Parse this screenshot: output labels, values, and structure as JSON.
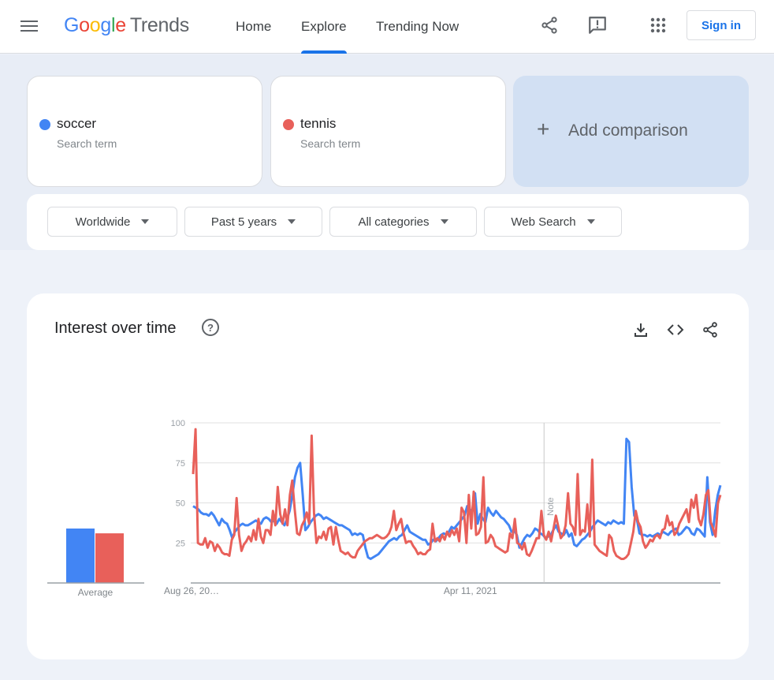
{
  "header": {
    "logo": {
      "google": "Google",
      "product": "Trends"
    },
    "nav": [
      {
        "label": "Home",
        "active": false
      },
      {
        "label": "Explore",
        "active": true
      },
      {
        "label": "Trending Now",
        "active": false
      }
    ],
    "icons": [
      "share-icon",
      "feedback-icon",
      "apps-icon"
    ],
    "sign_in_label": "Sign in",
    "accent_color": "#1a73e8"
  },
  "terms": [
    {
      "term": "soccer",
      "subtitle": "Search term",
      "color": "#4285f4"
    },
    {
      "term": "tennis",
      "subtitle": "Search term",
      "color": "#e8605a"
    }
  ],
  "add_comparison": {
    "icon": "+",
    "label": "Add comparison"
  },
  "filters": [
    {
      "label": "Worldwide"
    },
    {
      "label": "Past 5 years"
    },
    {
      "label": "All categories"
    },
    {
      "label": "Web Search"
    }
  ],
  "card": {
    "title": "Interest over time",
    "help_icon": "?",
    "actions": [
      "download-icon",
      "embed-icon",
      "share-icon"
    ]
  },
  "chart_data": [
    {
      "type": "bar",
      "title": "Average",
      "categories": [
        "Average"
      ],
      "series": [
        {
          "name": "soccer",
          "color": "#4285f4",
          "values": [
            34
          ]
        },
        {
          "name": "tennis",
          "color": "#e8605a",
          "values": [
            31
          ]
        }
      ],
      "xlabel": "Average",
      "ylim": [
        0,
        100
      ]
    },
    {
      "type": "line",
      "title": "Interest over time",
      "xlabel": "",
      "ylabel": "",
      "ylim": [
        0,
        100
      ],
      "yticks": [
        25,
        50,
        75,
        100
      ],
      "xtick_labels": [
        {
          "label": "Aug 26, 20…",
          "position": 0.0
        },
        {
          "label": "Apr 11, 2021",
          "position": 0.528
        }
      ],
      "note_marker": {
        "label": "Note",
        "position": 0.667
      },
      "grid": true,
      "legend": "none",
      "series": [
        {
          "name": "soccer",
          "color": "#4285f4",
          "values": [
            48,
            47,
            46,
            44,
            43,
            43,
            42,
            44,
            42,
            39,
            36,
            40,
            38,
            37,
            33,
            28,
            32,
            34,
            36,
            37,
            36,
            36,
            37,
            38,
            39,
            38,
            37,
            40,
            41,
            40,
            38,
            39,
            37,
            40,
            38,
            36,
            40,
            45,
            55,
            66,
            72,
            75,
            55,
            33,
            35,
            38,
            40,
            42,
            43,
            42,
            40,
            41,
            40,
            39,
            38,
            37,
            36,
            36,
            35,
            34,
            33,
            30,
            31,
            30,
            31,
            30,
            22,
            16,
            15,
            16,
            17,
            18,
            20,
            22,
            24,
            26,
            27,
            28,
            27,
            29,
            30,
            33,
            36,
            32,
            31,
            30,
            29,
            28,
            27,
            27,
            24,
            25,
            27,
            26,
            28,
            30,
            31,
            30,
            32,
            35,
            34,
            36,
            38,
            40,
            42,
            48,
            45,
            46,
            56,
            37,
            43,
            40,
            38,
            47,
            44,
            42,
            45,
            43,
            41,
            40,
            38,
            36,
            32,
            33,
            30,
            22,
            25,
            28,
            30,
            29,
            31,
            34,
            33,
            31,
            30,
            28,
            29,
            30,
            33,
            36,
            32,
            31,
            30,
            33,
            29,
            31,
            24,
            23,
            25,
            27,
            28,
            30,
            32,
            35,
            37,
            39,
            38,
            37,
            36,
            38,
            37,
            39,
            38,
            37,
            38,
            37,
            90,
            88,
            60,
            42,
            40,
            31,
            30,
            30,
            29,
            30,
            29,
            30,
            31,
            30,
            32,
            31,
            30,
            32,
            33,
            34,
            30,
            31,
            33,
            35,
            34,
            31,
            30,
            34,
            33,
            31,
            29,
            66,
            38,
            30,
            45,
            55,
            61
          ]
        },
        {
          "name": "tennis",
          "color": "#e8605a",
          "values": [
            68,
            96,
            25,
            24,
            24,
            28,
            22,
            26,
            25,
            20,
            24,
            22,
            19,
            18,
            18,
            17,
            27,
            30,
            53,
            30,
            20,
            24,
            26,
            29,
            26,
            33,
            27,
            40,
            29,
            25,
            33,
            33,
            30,
            45,
            36,
            60,
            43,
            37,
            46,
            36,
            55,
            64,
            46,
            31,
            30,
            36,
            39,
            44,
            37,
            92,
            44,
            25,
            29,
            28,
            32,
            27,
            34,
            35,
            24,
            35,
            27,
            20,
            19,
            18,
            19,
            17,
            16,
            16,
            20,
            22,
            24,
            26,
            27,
            28,
            28,
            29,
            30,
            29,
            28,
            28,
            29,
            31,
            35,
            45,
            33,
            37,
            40,
            31,
            25,
            26,
            26,
            23,
            21,
            18,
            19,
            18,
            18,
            20,
            21,
            37,
            26,
            28,
            26,
            30,
            27,
            32,
            29,
            33,
            30,
            34,
            26,
            47,
            44,
            25,
            55,
            34,
            57,
            30,
            31,
            35,
            66,
            25,
            26,
            30,
            28,
            23,
            22,
            21,
            20,
            19,
            20,
            31,
            28,
            40,
            25,
            24,
            21,
            25,
            18,
            17,
            20,
            24,
            28,
            28,
            45,
            30,
            27,
            32,
            26,
            34,
            42,
            35,
            28,
            30,
            36,
            56,
            37,
            35,
            30,
            68,
            30,
            33,
            32,
            49,
            29,
            77,
            24,
            22,
            20,
            19,
            18,
            17,
            30,
            28,
            20,
            17,
            16,
            15,
            15,
            16,
            18,
            25,
            32,
            45,
            38,
            35,
            26,
            22,
            24,
            27,
            26,
            29,
            30,
            28,
            33,
            34,
            42,
            36,
            38,
            30,
            32,
            37,
            40,
            43,
            46,
            38,
            52,
            47,
            55,
            40,
            36,
            43,
            55,
            58,
            38,
            34,
            29,
            50,
            55
          ]
        }
      ]
    }
  ]
}
